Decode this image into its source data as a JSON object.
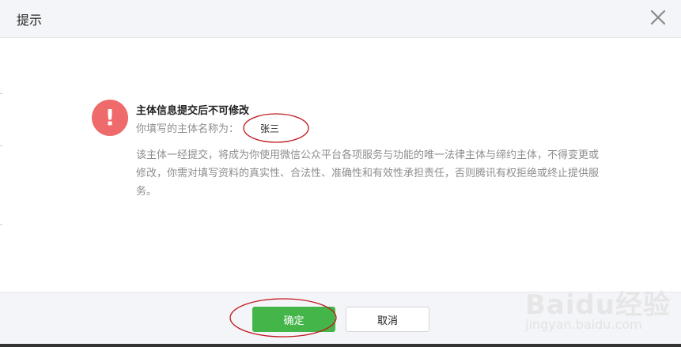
{
  "dialog": {
    "title": "提示",
    "close_icon": "close-icon"
  },
  "message": {
    "icon": "exclamation-icon",
    "icon_glyph": "!",
    "heading": "主体信息提交后不可修改",
    "name_label": "你填写的主体名称为：",
    "name_value": "张三",
    "description": "该主体一经提交，将成为你使用微信公众平台各项服务与功能的唯一法律主体与缔约主体，不得变更或修改，你需对填写资料的真实性、合法性、准确性和有效性承担责任，否则腾讯有权拒绝或终止提供服务。"
  },
  "footer": {
    "ok_label": "确定",
    "cancel_label": "取消"
  },
  "watermark": {
    "brand": "Baidu经验",
    "url": "jingyan.baidu.com"
  },
  "colors": {
    "header_bg": "#f4f5f9",
    "ok_button": "#44b549",
    "warning_icon": "#ef6a6a",
    "annotation": "#c0161b"
  }
}
